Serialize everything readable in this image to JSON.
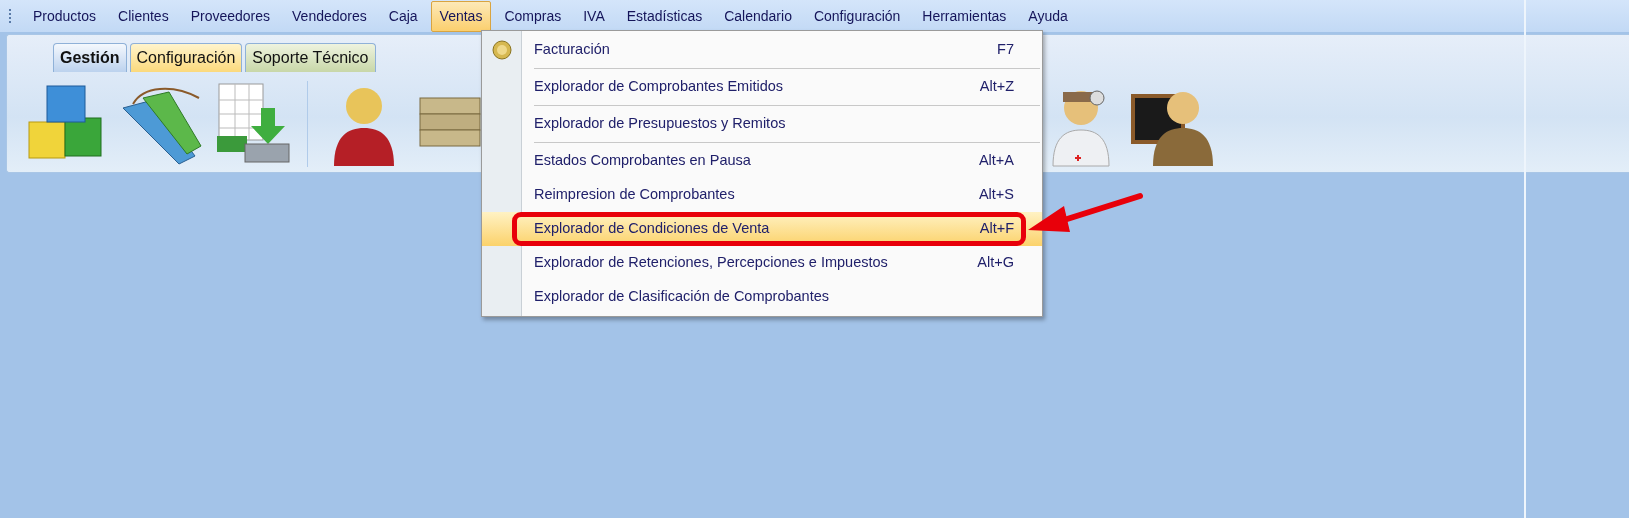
{
  "menu_bar": [
    {
      "label": "Productos",
      "selected": false
    },
    {
      "label": "Clientes",
      "selected": false
    },
    {
      "label": "Proveedores",
      "selected": false
    },
    {
      "label": "Vendedores",
      "selected": false
    },
    {
      "label": "Caja",
      "selected": false
    },
    {
      "label": "Ventas",
      "selected": true
    },
    {
      "label": "Compras",
      "selected": false
    },
    {
      "label": "IVA",
      "selected": false
    },
    {
      "label": "Estadísticas",
      "selected": false
    },
    {
      "label": "Calendario",
      "selected": false
    },
    {
      "label": "Configuración",
      "selected": false
    },
    {
      "label": "Herramientas",
      "selected": false
    },
    {
      "label": "Ayuda",
      "selected": false
    }
  ],
  "ribbon_tabs": [
    {
      "label": "Gestión",
      "selected": true
    },
    {
      "label": "Configuración",
      "selected": false
    },
    {
      "label": "Soporte Técnico",
      "selected": false
    }
  ],
  "dropdown_menu": [
    {
      "label": "Facturación",
      "shortcut": "F7",
      "selected": false,
      "separator_after": true
    },
    {
      "label": "Explorador de Comprobantes Emitidos",
      "shortcut": "Alt+Z",
      "selected": false,
      "separator_after": true
    },
    {
      "label": "Explorador de Presupuestos y Remitos",
      "selected": false,
      "separator_after": true
    },
    {
      "label": "Estados Comprobantes en Pausa",
      "shortcut": "Alt+A",
      "selected": false,
      "separator_after": false
    },
    {
      "label": "Reimpresion de Comprobantes",
      "shortcut": "Alt+S",
      "selected": false,
      "separator_after": false
    },
    {
      "label": "Explorador de Condiciones de Venta",
      "shortcut": "Alt+F",
      "selected": true,
      "separator_after": false
    },
    {
      "label": "Explorador de Retenciones, Percepciones e Impuestos",
      "shortcut": "Alt+G",
      "selected": false,
      "separator_after": false
    },
    {
      "label": "Explorador de Clasificación de Comprobantes",
      "selected": false,
      "separator_after": false
    }
  ]
}
